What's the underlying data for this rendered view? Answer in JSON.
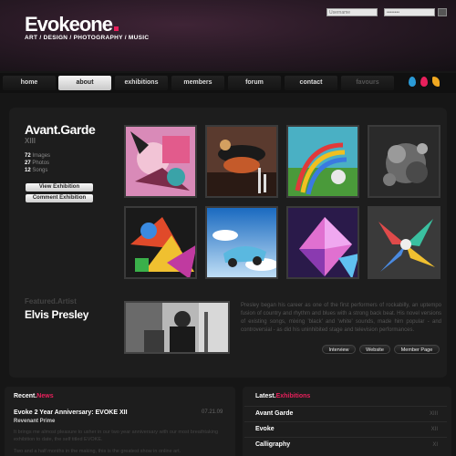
{
  "header": {
    "logo": "Evokeone",
    "tagline": "ART / DESIGN / PHOTOGRAPHY / MUSIC",
    "username_placeholder": "Username",
    "password_placeholder": "••••••••"
  },
  "nav": {
    "items": [
      {
        "label": "home",
        "active": false
      },
      {
        "label": "about",
        "active": true
      },
      {
        "label": "exhibitions",
        "active": false
      },
      {
        "label": "members",
        "active": false
      },
      {
        "label": "forum",
        "active": false
      },
      {
        "label": "contact",
        "active": false
      },
      {
        "label": "favours",
        "active": false,
        "disabled": true
      }
    ],
    "color_swatches": [
      "#2a9ad6",
      "#e8205c",
      "#f0a820"
    ]
  },
  "exhibition": {
    "title": "Avant.Garde",
    "subtitle": "XIII",
    "stats": [
      {
        "count": "72",
        "label": "Images"
      },
      {
        "count": "27",
        "label": "Photos"
      },
      {
        "count": "12",
        "label": "Songs"
      }
    ],
    "view_button": "View Exhibition",
    "comment_button": "Comment Exhibition",
    "thumbnails": [
      {
        "icon": "collage-art-thumbnail"
      },
      {
        "icon": "teapot-sculpture-thumbnail"
      },
      {
        "icon": "rainbow-swirl-thumbnail"
      },
      {
        "icon": "dark-sculpture-thumbnail"
      },
      {
        "icon": "abstract-shapes-thumbnail"
      },
      {
        "icon": "floating-car-thumbnail"
      },
      {
        "icon": "neon-crystal-thumbnail"
      },
      {
        "icon": "geometric-explosion-thumbnail"
      }
    ]
  },
  "featured_artist": {
    "label": "Featured.Artist",
    "name": "Elvis Presley",
    "bio": "Presley began his career as one of the first performers of rockabilly, an uptempo fusion of country and rhythm and blues with a strong back beat. His novel versions of existing songs, mixing 'black' and 'white' sounds, made him popular - and controversial - as did his uninhibited stage and television performances.",
    "buttons": [
      "Interview",
      "Website",
      "Member Page"
    ]
  },
  "news": {
    "heading_white": "Recent.",
    "heading_red": "News",
    "title": "Evoke 2 Year Anniversary: EVOKE XII",
    "author": "Revenant Prime",
    "date": "07.21.09",
    "body": "It brings me almost pleasure to usher in our two year anniversary with our most breathtaking exhibition to date, the self titled EVOKE.",
    "more": "Two and a half months in the making, this is the greatest show in online art."
  },
  "latest": {
    "heading_white": "Latest.",
    "heading_red": "Exhibitions",
    "items": [
      {
        "name": "Avant Garde",
        "count": "XIII"
      },
      {
        "name": "Evoke",
        "count": "XII"
      },
      {
        "name": "Calligraphy",
        "count": "XI"
      }
    ]
  }
}
